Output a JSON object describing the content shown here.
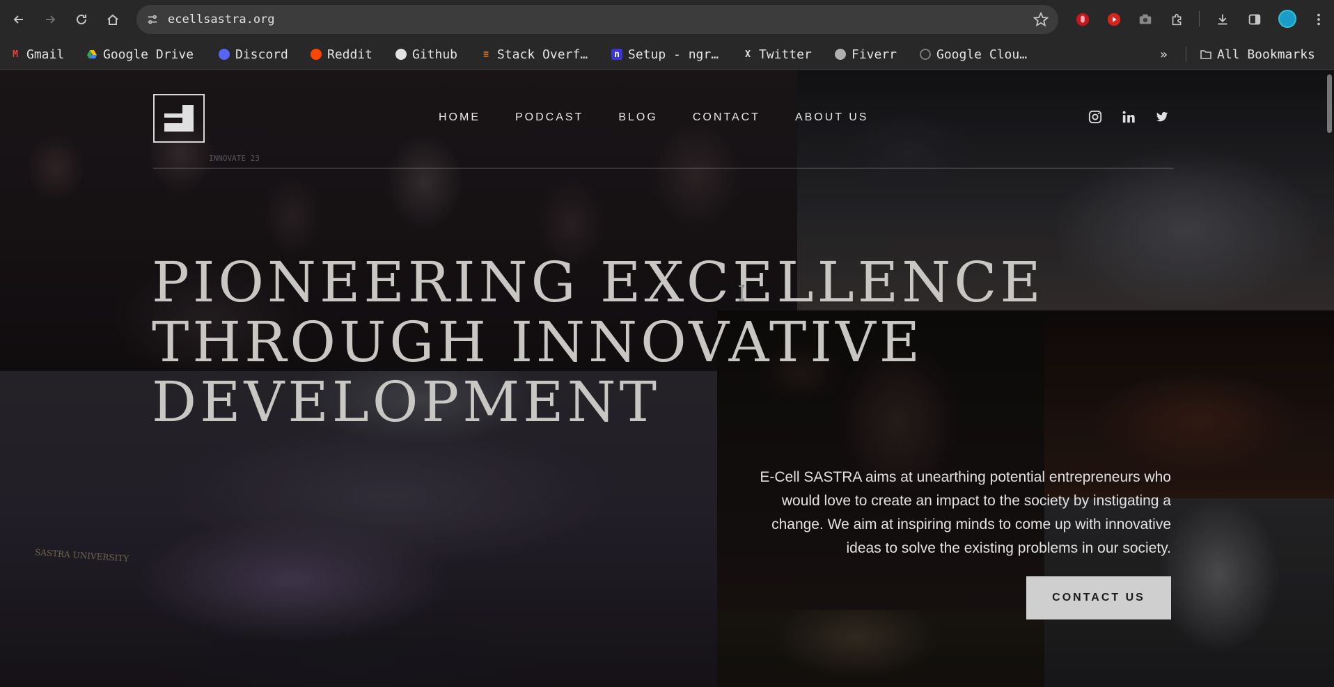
{
  "browser": {
    "url": "ecellsastra.org",
    "bookmarks": [
      {
        "label": "Gmail",
        "icon": "gmail-icon",
        "color": "#ea4335"
      },
      {
        "label": "Google Drive",
        "icon": "google-drive-icon",
        "color": "#34a853"
      },
      {
        "label": "Discord",
        "icon": "discord-icon",
        "color": "#5865f2"
      },
      {
        "label": "Reddit",
        "icon": "reddit-icon",
        "color": "#ff4500"
      },
      {
        "label": "Github",
        "icon": "github-icon",
        "color": "#e3e3e3"
      },
      {
        "label": "Stack Overf…",
        "icon": "stack-overflow-icon",
        "color": "#f48024"
      },
      {
        "label": "Setup - ngr…",
        "icon": "ngrok-icon",
        "color": "#3b35d6"
      },
      {
        "label": "Twitter",
        "icon": "x-twitter-icon",
        "color": "#e3e3e3"
      },
      {
        "label": "Fiverr",
        "icon": "globe-icon",
        "color": "#b0b0b0"
      },
      {
        "label": "Google Clou…",
        "icon": "google-cloud-icon",
        "color": "#7a7a7a"
      }
    ],
    "all_bookmarks_label": "All Bookmarks",
    "overflow_label": "»"
  },
  "site": {
    "nav": [
      "HOME",
      "PODCAST",
      "BLOG",
      "CONTACT",
      "ABOUT US"
    ],
    "socials": [
      "instagram-icon",
      "linkedin-icon",
      "twitter-icon"
    ],
    "hero": {
      "title_lines": [
        "PIONEERING EXCELLENCE",
        "THROUGH INNOVATIVE",
        "DEVELOPMENT"
      ],
      "description": "E-Cell SASTRA aims at unearthing potential entrepreneurs who would love to create an impact to the society by instigating a change. We aim at inspiring minds to come up with innovative ideas to solve the existing problems in our society.",
      "cta": "CONTACT US"
    },
    "photo_texts": {
      "banner": "INNOVATE 23",
      "signboard": "SASTRA UNIVERSITY"
    }
  },
  "colors": {
    "browser_bg": "#282828",
    "cta_bg": "#cfcfcf",
    "title_text": "#c9c7c4"
  }
}
